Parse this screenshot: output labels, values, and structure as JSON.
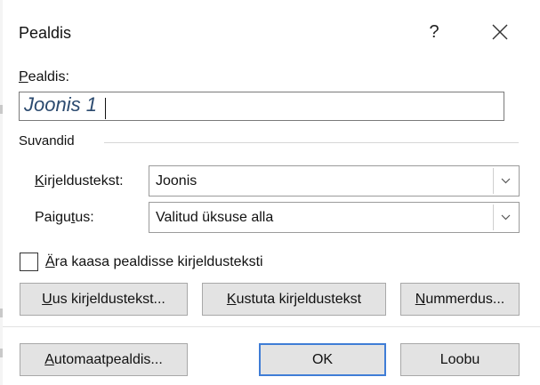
{
  "dialog": {
    "title": "Pealdis",
    "help_label": "?",
    "close_icon": "close-icon"
  },
  "caption": {
    "label_underlined": "P",
    "label_rest": "ealdis:",
    "value": "Joonis 1"
  },
  "options": {
    "group_title": "Suvandid",
    "label_field": {
      "label_underlined": "K",
      "label_rest": "irjeldustekst:",
      "value": "Joonis"
    },
    "position_field": {
      "label_before": "Paigu",
      "label_underlined": "t",
      "label_after": "us:",
      "value": "Valitud üksuse alla"
    }
  },
  "exclude_label": {
    "checked": false,
    "text_underlined": "Ä",
    "text_rest": "ra kaasa pealdisse kirjeldusteksti"
  },
  "buttons": {
    "new_label": {
      "underlined": "U",
      "rest": "us kirjeldustekst..."
    },
    "delete_label": {
      "underlined": "K",
      "rest": "ustuta kirjeldustekst"
    },
    "numbering": {
      "underlined": "N",
      "rest": "ummerdus..."
    },
    "autocaption": {
      "underlined": "A",
      "rest": "utomaatpealdis..."
    },
    "ok": "OK",
    "cancel": "Loobu"
  },
  "colors": {
    "primary_button_border": "#3f7dd6",
    "button_face": "#e3e3e3",
    "caption_text": "#2b4a6f"
  }
}
